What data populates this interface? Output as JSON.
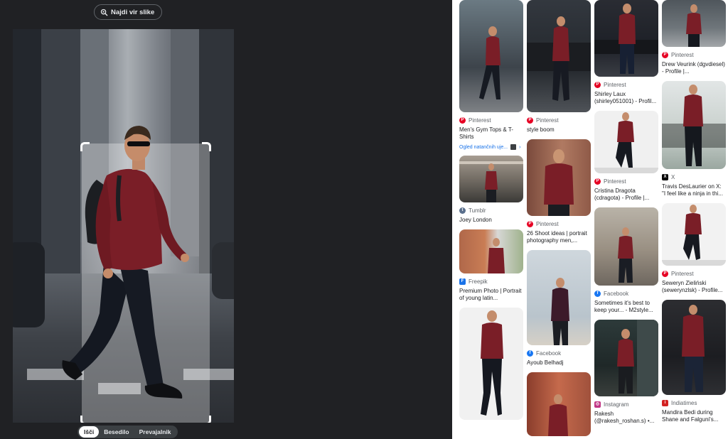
{
  "left": {
    "find_source_label": "Najdi vir slike",
    "tabs": [
      {
        "label": "Išči",
        "active": true
      },
      {
        "label": "Besedilo",
        "active": false
      },
      {
        "label": "Prevajalnik",
        "active": false
      }
    ]
  },
  "colors": {
    "shirt": "#7a1e27",
    "pinterest": "#e60023",
    "facebook": "#1877f2",
    "link": "#1a73e8"
  },
  "results": {
    "col1": [
      {
        "source": "Pinterest",
        "source_icon": "pinterest-icon",
        "title": "Men's Gym Tops & T-Shirts",
        "link": "Ogled natančnih uje..."
      },
      {
        "source": "Tumblr",
        "source_icon": "tumblr-icon",
        "title": "Joey London"
      },
      {
        "source": "Freepik",
        "source_icon": "freepik-icon",
        "title": "Premium Photo | Portrait of young latin..."
      },
      {
        "source": "",
        "source_icon": "",
        "title": ""
      }
    ],
    "col2": [
      {
        "source": "Pinterest",
        "source_icon": "pinterest-icon",
        "title": "style boom"
      },
      {
        "source": "Pinterest",
        "source_icon": "pinterest-icon",
        "title": "26 Shoot ideas | portrait photography men,..."
      },
      {
        "source": "Facebook",
        "source_icon": "facebook-icon",
        "title": "Ayoub Belhadj"
      },
      {
        "source": "",
        "source_icon": "",
        "title": ""
      }
    ],
    "col3": [
      {
        "source": "Pinterest",
        "source_icon": "pinterest-icon",
        "title": "Shirley Laux (shirley051001) - Profil..."
      },
      {
        "source": "Pinterest",
        "source_icon": "pinterest-icon",
        "title": "Cristina Dragota (cdragota) - Profile |..."
      },
      {
        "source": "Facebook",
        "source_icon": "facebook-icon",
        "title": "Sometimes it's best to keep your... - M2style..."
      },
      {
        "source": "Instagram",
        "source_icon": "instagram-icon",
        "title": "Rakesh (@rakesh_roshan.s) •..."
      }
    ],
    "col4": [
      {
        "source": "Pinterest",
        "source_icon": "pinterest-icon",
        "title": "Drew Veurink (dgvdiesel) - Profile |..."
      },
      {
        "source": "X",
        "source_icon": "x-icon",
        "title": "Travis DesLaurier on X: \"I feel like a ninja in thi..."
      },
      {
        "source": "Pinterest",
        "source_icon": "pinterest-icon",
        "title": "Seweryn Zieliński (sewerynzlsk) - Profile..."
      },
      {
        "source": "Indiatimes",
        "source_icon": "indiatimes-icon",
        "title": "Mandira Bedi during Shane and Falguni's..."
      }
    ]
  }
}
